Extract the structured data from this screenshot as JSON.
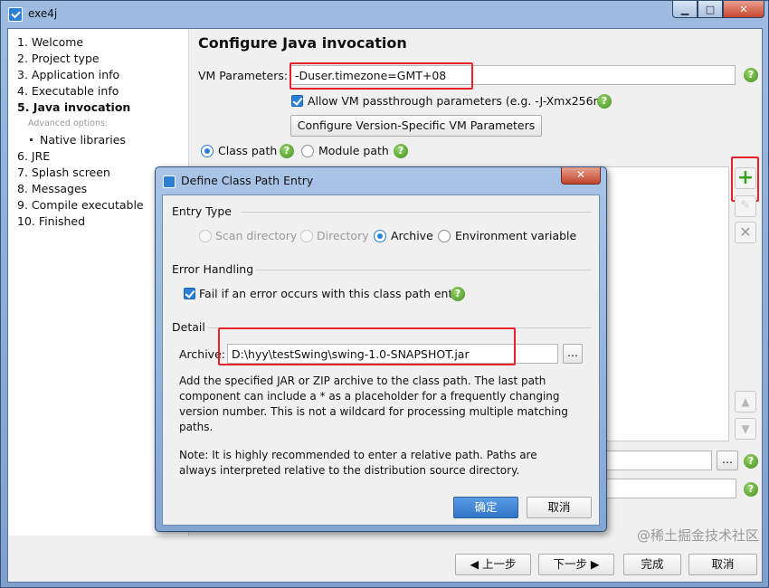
{
  "window": {
    "title": "exe4j"
  },
  "steps": [
    {
      "label": "1. Welcome",
      "kind": "step"
    },
    {
      "label": "2. Project type",
      "kind": "step"
    },
    {
      "label": "3. Application info",
      "kind": "step"
    },
    {
      "label": "4. Executable info",
      "kind": "step"
    },
    {
      "label": "5. Java invocation",
      "kind": "active"
    },
    {
      "label": "Advanced options:",
      "kind": "adv"
    },
    {
      "label": "Native libraries",
      "kind": "sub"
    },
    {
      "label": "6. JRE",
      "kind": "step"
    },
    {
      "label": "7. Splash screen",
      "kind": "step"
    },
    {
      "label": "8. Messages",
      "kind": "step"
    },
    {
      "label": "9. Compile executable",
      "kind": "step"
    },
    {
      "label": "10. Finished",
      "kind": "step"
    }
  ],
  "main": {
    "title": "Configure Java invocation",
    "vm_label": "VM Parameters:",
    "vm_value": "-Duser.timezone=GMT+08",
    "passthrough_label": "Allow VM passthrough parameters (e.g. -J-Xmx256m)",
    "configure_button": "Configure Version-Specific VM Parameters",
    "classpath_radio": "Class path",
    "modulepath_radio": "Module path",
    "help_char": "?"
  },
  "toolbar": {
    "plus": "+",
    "edit": "✎",
    "remove": "✕",
    "up": "▲",
    "down": "▼",
    "browse": "..."
  },
  "nav": {
    "back": "上一步",
    "next": "下一步",
    "finish": "完成",
    "cancel": "取消"
  },
  "watermark": "@稀土掘金技术社区",
  "dialog": {
    "title": "Define Class Path Entry",
    "close_glyph": "✕",
    "entry_type": {
      "heading": "Entry Type",
      "options": [
        "Scan directory",
        "Directory",
        "Archive",
        "Environment variable"
      ],
      "selected": "Archive"
    },
    "error_handling": {
      "heading": "Error Handling",
      "fail_label": "Fail if an error occurs with this class path entry"
    },
    "detail": {
      "heading": "Detail",
      "archive_label": "Archive:",
      "archive_value": "D:\\hyy\\testSwing\\swing-1.0-SNAPSHOT.jar",
      "browse": "...",
      "description": "Add the specified JAR or ZIP archive to the class path. The last path component can include a * as a placeholder for a frequently changing version number. This is not a wildcard for processing multiple matching paths.",
      "note": "Note: It is highly recommended to enter a relative path. Paths are always interpreted relative to the distribution source directory."
    },
    "ok_button": "确定",
    "cancel_button": "取消"
  },
  "colors": {
    "accent": "#2a7fd6",
    "highlight": "#e8222b",
    "help": "#3f8f1c"
  }
}
